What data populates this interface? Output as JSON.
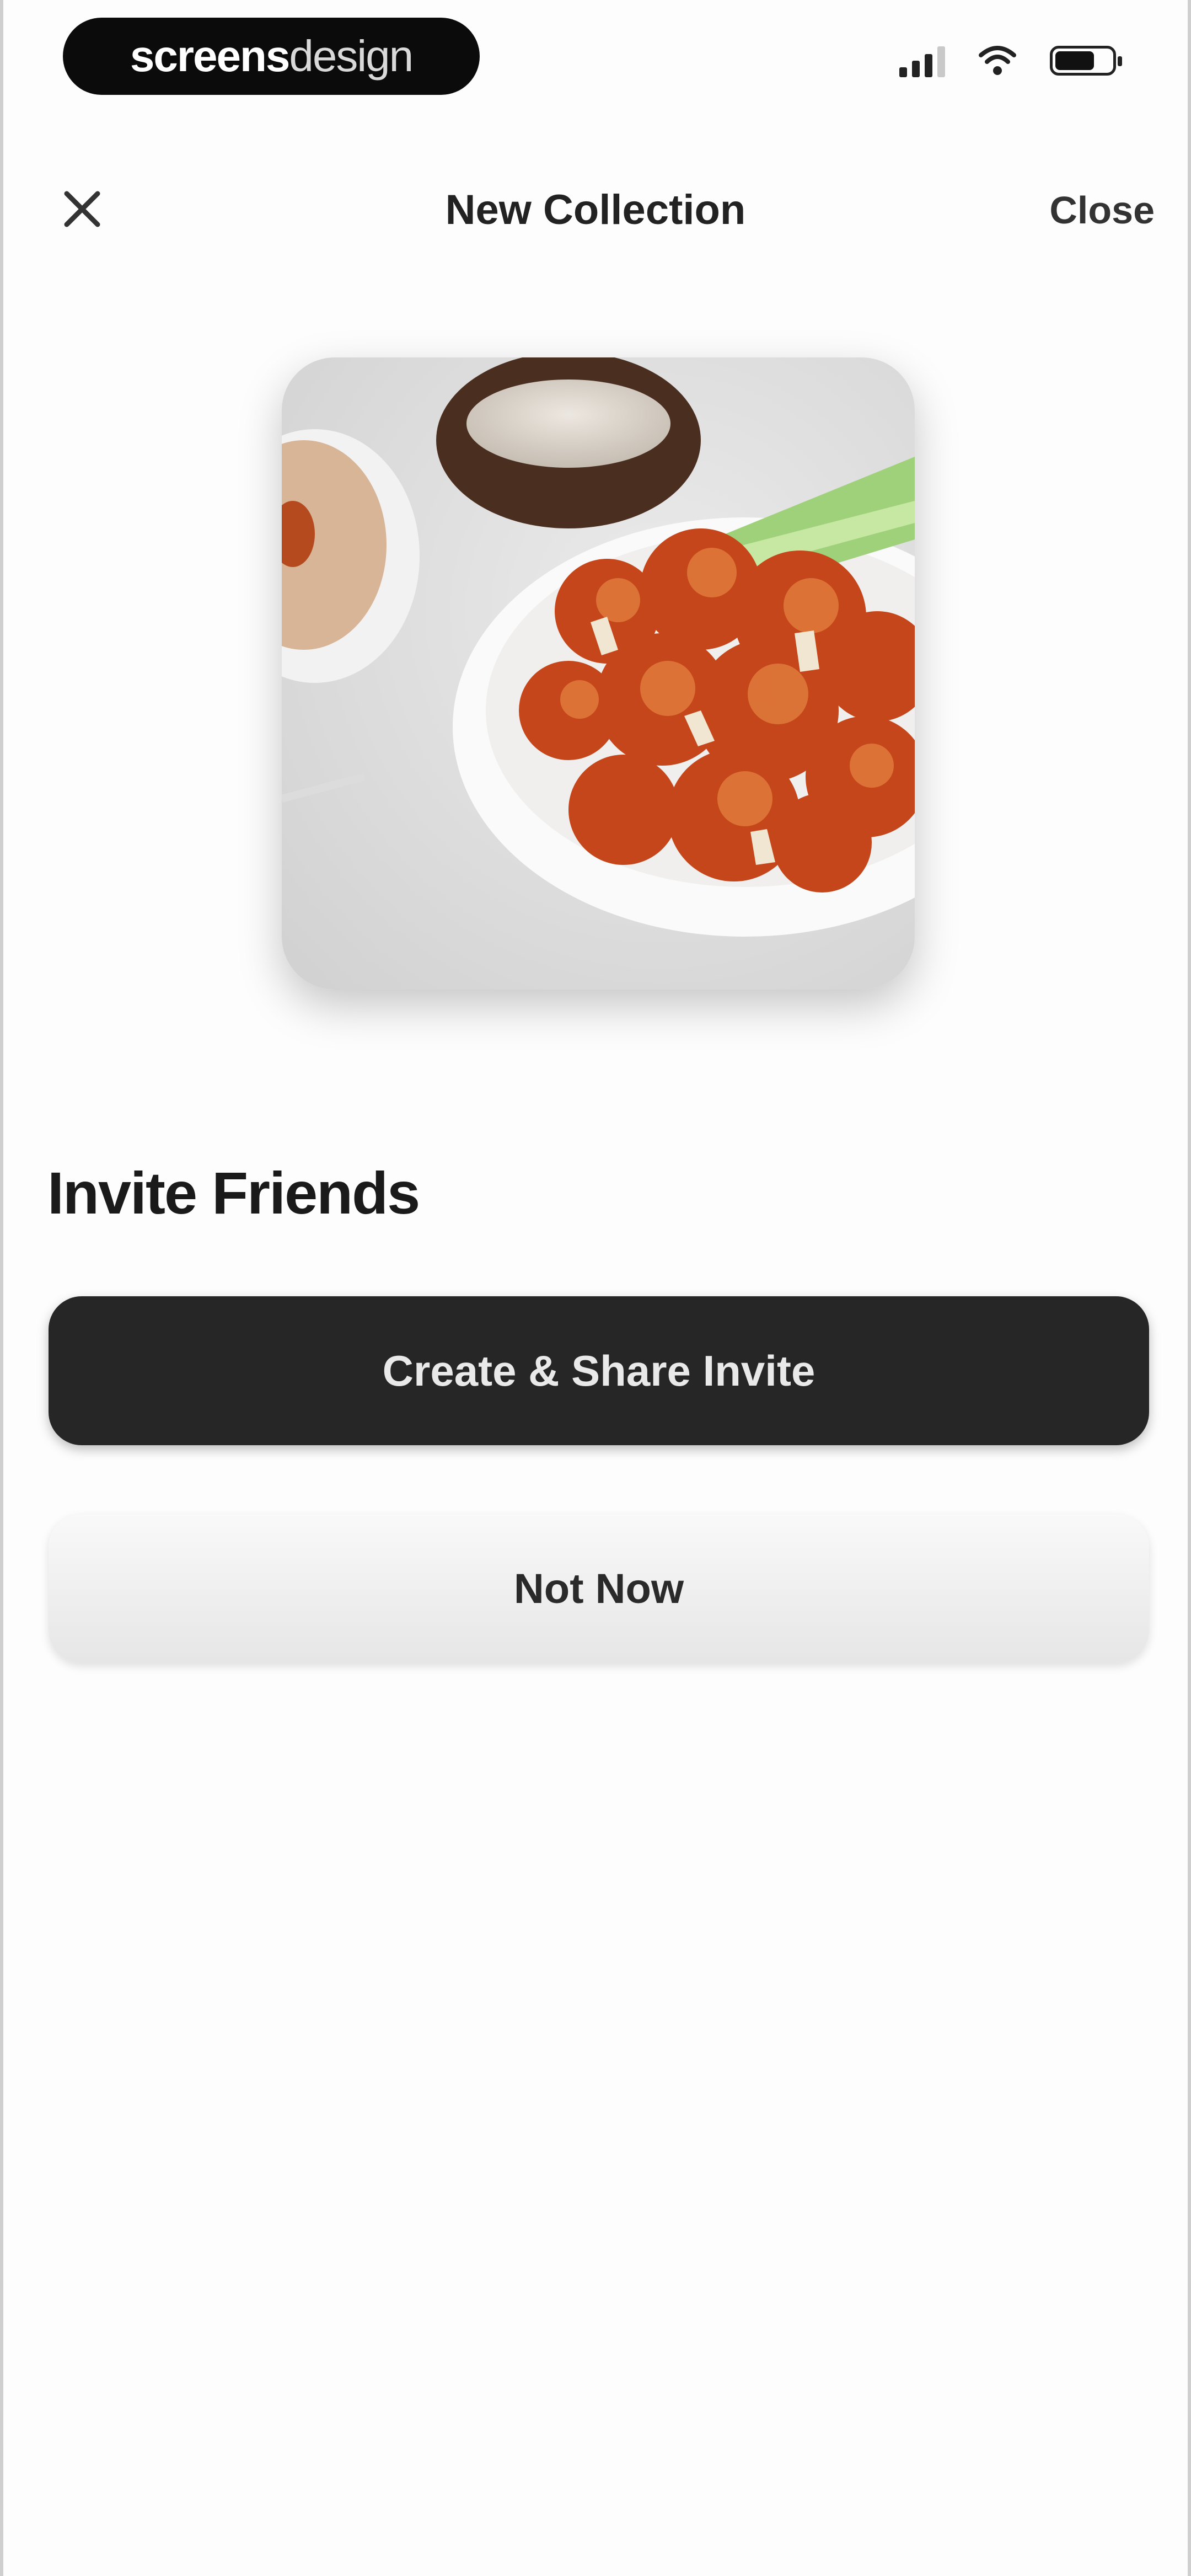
{
  "watermark": {
    "part1": "screens",
    "part2": "design"
  },
  "status_bar": {
    "signal_icon": "signal-bars-icon",
    "wifi_icon": "wifi-icon",
    "battery_icon": "battery-icon"
  },
  "nav": {
    "title": "New Collection",
    "close_label": "Close",
    "dismiss_icon": "close-icon"
  },
  "hero_image": {
    "subject": "buffalo cauliflower bites with celery and dip"
  },
  "section": {
    "heading": "Invite Friends"
  },
  "actions": {
    "primary_label": "Create & Share Invite",
    "secondary_label": "Not Now"
  },
  "colors": {
    "primary_button": "#262626",
    "secondary_button": "#efefef",
    "background": "#ffffff"
  }
}
